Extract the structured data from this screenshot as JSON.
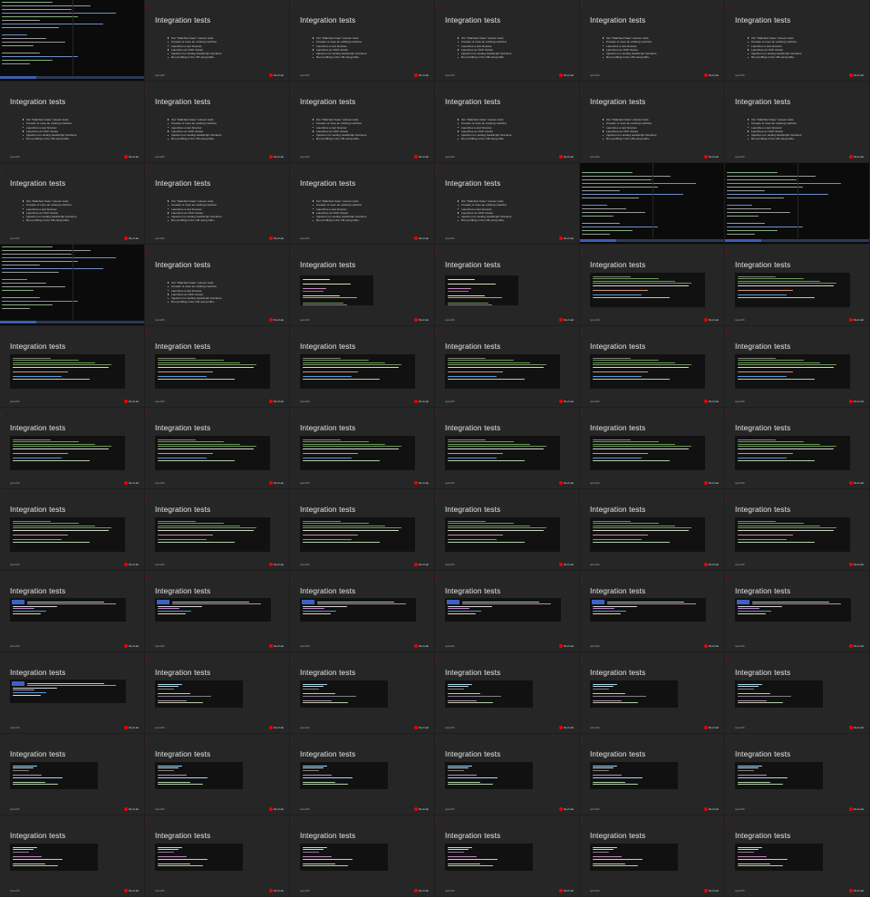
{
  "slide_title": "Integration tests",
  "footer_text": "openshift",
  "brand_name": "Red Hat",
  "bullets": [
    "Our \"Matched Case\" cutover tests",
    "Creates or uses an existing machine",
    "Launches a test browser",
    "Launches an OCP cluster",
    "Injection run testing JavaScript functions",
    "Run profiling in the VM using Glib+"
  ],
  "colors": {
    "background": "#262626",
    "code_background": "#111111",
    "brand_red": "#ee0000",
    "highlight_blue": "#3c62c6"
  },
  "thumbnails": [
    {
      "type": "terminal"
    },
    {
      "type": "bullets"
    },
    {
      "type": "bullets"
    },
    {
      "type": "bullets"
    },
    {
      "type": "bullets"
    },
    {
      "type": "bullets"
    },
    {
      "type": "bullets"
    },
    {
      "type": "bullets"
    },
    {
      "type": "bullets"
    },
    {
      "type": "bullets"
    },
    {
      "type": "bullets"
    },
    {
      "type": "bullets"
    },
    {
      "type": "bullets"
    },
    {
      "type": "bullets"
    },
    {
      "type": "bullets"
    },
    {
      "type": "bullets"
    },
    {
      "type": "terminal-wide"
    },
    {
      "type": "terminal-wide2"
    },
    {
      "type": "terminal"
    },
    {
      "type": "bullets"
    },
    {
      "type": "code-a"
    },
    {
      "type": "code-a"
    },
    {
      "type": "code-b"
    },
    {
      "type": "code-b"
    },
    {
      "type": "code-b"
    },
    {
      "type": "code-b"
    },
    {
      "type": "code-b"
    },
    {
      "type": "code-b"
    },
    {
      "type": "code-b"
    },
    {
      "type": "code-b"
    },
    {
      "type": "code-b"
    },
    {
      "type": "code-b"
    },
    {
      "type": "code-b"
    },
    {
      "type": "code-b"
    },
    {
      "type": "code-b"
    },
    {
      "type": "code-b"
    },
    {
      "type": "code-b"
    },
    {
      "type": "code-b"
    },
    {
      "type": "code-b"
    },
    {
      "type": "code-b"
    },
    {
      "type": "code-b"
    },
    {
      "type": "code-b"
    },
    {
      "type": "code-c"
    },
    {
      "type": "code-c"
    },
    {
      "type": "code-c"
    },
    {
      "type": "code-c"
    },
    {
      "type": "code-c"
    },
    {
      "type": "code-c"
    },
    {
      "type": "code-c"
    },
    {
      "type": "code-d"
    },
    {
      "type": "code-d"
    },
    {
      "type": "code-d"
    },
    {
      "type": "code-d"
    },
    {
      "type": "code-d"
    },
    {
      "type": "code-e"
    },
    {
      "type": "code-e"
    },
    {
      "type": "code-e"
    },
    {
      "type": "code-e"
    },
    {
      "type": "code-e"
    },
    {
      "type": "code-e"
    },
    {
      "type": "code-e"
    },
    {
      "type": "code-e"
    },
    {
      "type": "code-e"
    },
    {
      "type": "code-e"
    },
    {
      "type": "code-e"
    },
    {
      "type": "code-e"
    }
  ]
}
